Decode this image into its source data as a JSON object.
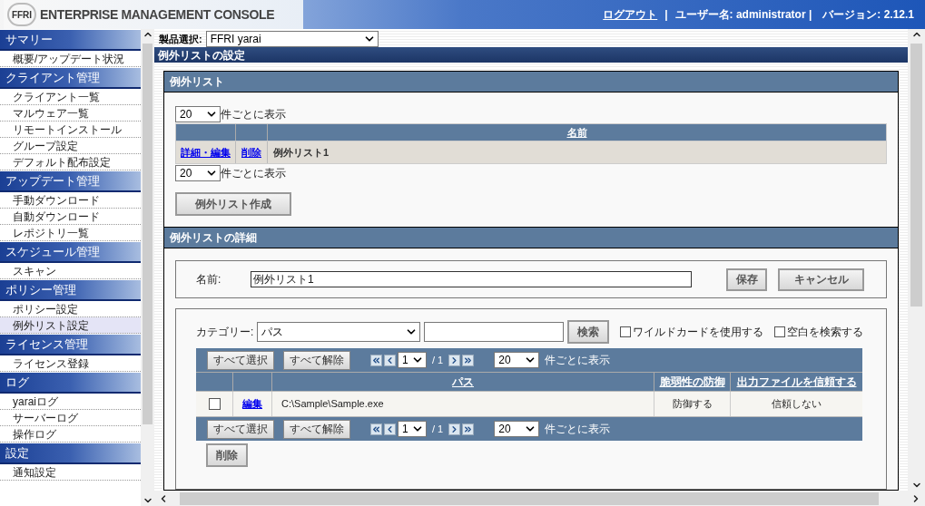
{
  "header": {
    "logo": "FFRI",
    "title": "ENTERPRISE MANAGEMENT CONSOLE",
    "logout": "ログアウト",
    "separator": "|",
    "user": "ユーザー名: administrator |",
    "version": "バージョン: 2.12.1"
  },
  "sidebar": {
    "groups": [
      {
        "title": "サマリー",
        "items": [
          {
            "label": "概要/アップデート状況",
            "selected": false
          }
        ]
      },
      {
        "title": "クライアント管理",
        "items": [
          {
            "label": "クライアント一覧",
            "selected": false
          },
          {
            "label": "マルウェア一覧",
            "selected": false
          },
          {
            "label": "リモートインストール",
            "selected": false
          },
          {
            "label": "グループ設定",
            "selected": false
          },
          {
            "label": "デフォルト配布設定",
            "selected": false
          }
        ]
      },
      {
        "title": "アップデート管理",
        "items": [
          {
            "label": "手動ダウンロード",
            "selected": false
          },
          {
            "label": "自動ダウンロード",
            "selected": false
          },
          {
            "label": "レポジトリ一覧",
            "selected": false
          }
        ]
      },
      {
        "title": "スケジュール管理",
        "items": [
          {
            "label": "スキャン",
            "selected": false
          }
        ]
      },
      {
        "title": "ポリシー管理",
        "items": [
          {
            "label": "ポリシー設定",
            "selected": false
          },
          {
            "label": "例外リスト設定",
            "selected": true
          }
        ]
      },
      {
        "title": "ライセンス管理",
        "items": [
          {
            "label": "ライセンス登録",
            "selected": false
          }
        ]
      },
      {
        "title": "ログ",
        "items": [
          {
            "label": "yaraiログ",
            "selected": false
          },
          {
            "label": "サーバーログ",
            "selected": false
          },
          {
            "label": "操作ログ",
            "selected": false
          }
        ]
      },
      {
        "title": "設定",
        "items": [
          {
            "label": "通知設定",
            "selected": false
          }
        ]
      }
    ]
  },
  "product": {
    "label": "製品選択:",
    "value": "FFRI yarai"
  },
  "page_title": "例外リストの設定",
  "list_section": {
    "title": "例外リスト",
    "per_page_top": {
      "value": "20",
      "label": "件ごとに表示"
    },
    "columns": [
      "名前"
    ],
    "rows": [
      {
        "edit": "詳細・編集",
        "delete": "削除",
        "name": "例外リスト1"
      }
    ],
    "per_page_bottom": {
      "value": "20",
      "label": "件ごとに表示"
    },
    "create_button": "例外リスト作成"
  },
  "detail_section": {
    "title": "例外リストの詳細",
    "name_label": "名前:",
    "name_value": "例外リスト1",
    "save_button": "保存",
    "cancel_button": "キャンセル",
    "search": {
      "category_label": "カテゴリー:",
      "category_value": "パス",
      "search_button": "検索",
      "options": [
        {
          "label": "ワイルドカードを使用する",
          "checked": false
        },
        {
          "label": "空白を検索する",
          "checked": false
        }
      ]
    },
    "toolbars": [
      {
        "select_all": "すべて選択",
        "clear_all": "すべて解除",
        "page": "1",
        "page_total": "/ 1",
        "per_page": "20",
        "per_page_label": "件ごとに表示"
      },
      {
        "select_all": "すべて選択",
        "clear_all": "すべて解除",
        "page": "1",
        "page_total": "/ 1",
        "per_page": "20",
        "per_page_label": "件ごとに表示"
      }
    ],
    "columns": [
      "パス",
      "脆弱性の防御",
      "出力ファイルを信頼する"
    ],
    "rows": [
      {
        "checked": false,
        "edit": "編集",
        "cells": [
          "C:\\Sample\\Sample.exe",
          "防御する",
          "信頼しない"
        ]
      }
    ],
    "delete_button": "削除"
  }
}
